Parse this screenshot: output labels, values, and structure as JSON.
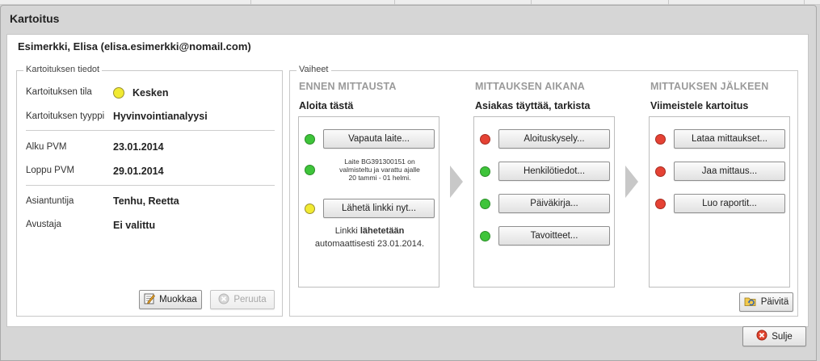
{
  "dialog": {
    "title": "Kartoitus"
  },
  "user": {
    "display": "Esimerkki, Elisa (elisa.esimerkki@nomail.com)"
  },
  "info": {
    "legend": "Kartoituksen tiedot",
    "status_label": "Kartoituksen tila",
    "status_value": "Kesken",
    "status_color": "#f1ea32",
    "type_label": "Kartoituksen tyyppi",
    "type_value": "Hyvinvointianalyysi",
    "start_label": "Alku PVM",
    "start_value": "23.01.2014",
    "end_label": "Loppu PVM",
    "end_value": "29.01.2014",
    "expert_label": "Asiantuntija",
    "expert_value": "Tenhu, Reetta",
    "assistant_label": "Avustaja",
    "assistant_value": "Ei valittu",
    "edit_label": "Muokkaa",
    "cancel_label": "Peruuta"
  },
  "steps": {
    "legend": "Vaiheet",
    "refresh_label": "Päivitä",
    "before": {
      "heading": "ENNEN MITTAUSTA",
      "sub": "Aloita tästä",
      "release_label": "Vapauta laite...",
      "device_note_1": "Laite BG391300151 on",
      "device_note_2": "valmisteltu ja varattu ajalle",
      "device_note_3": "20 tammi - 01 helmi.",
      "send_link_label": "Lähetä linkki nyt...",
      "link_note_prefix": "Linkki ",
      "link_note_bold": "lähetetään",
      "link_note_suffix": "automaattisesti 23.01.2014."
    },
    "during": {
      "heading": "MITTAUKSEN AIKANA",
      "sub": "Asiakas täyttää, tarkista",
      "items": [
        {
          "label": "Aloituskysely...",
          "status": "red"
        },
        {
          "label": "Henkilötiedot...",
          "status": "green"
        },
        {
          "label": "Päiväkirja...",
          "status": "green"
        },
        {
          "label": "Tavoitteet...",
          "status": "green"
        }
      ]
    },
    "after": {
      "heading": "MITTAUKSEN JÄLKEEN",
      "sub": "Viimeistele kartoitus",
      "items": [
        {
          "label": "Lataa mittaukset...",
          "status": "red"
        },
        {
          "label": "Jaa mittaus...",
          "status": "red"
        },
        {
          "label": "Luo raportit...",
          "status": "red"
        }
      ]
    }
  },
  "footer": {
    "close_label": "Sulje"
  },
  "icons": {
    "edit": "pencil-paper-icon",
    "cancel": "circle-x-icon",
    "refresh": "folder-refresh-icon",
    "close": "red-circle-x-icon"
  }
}
